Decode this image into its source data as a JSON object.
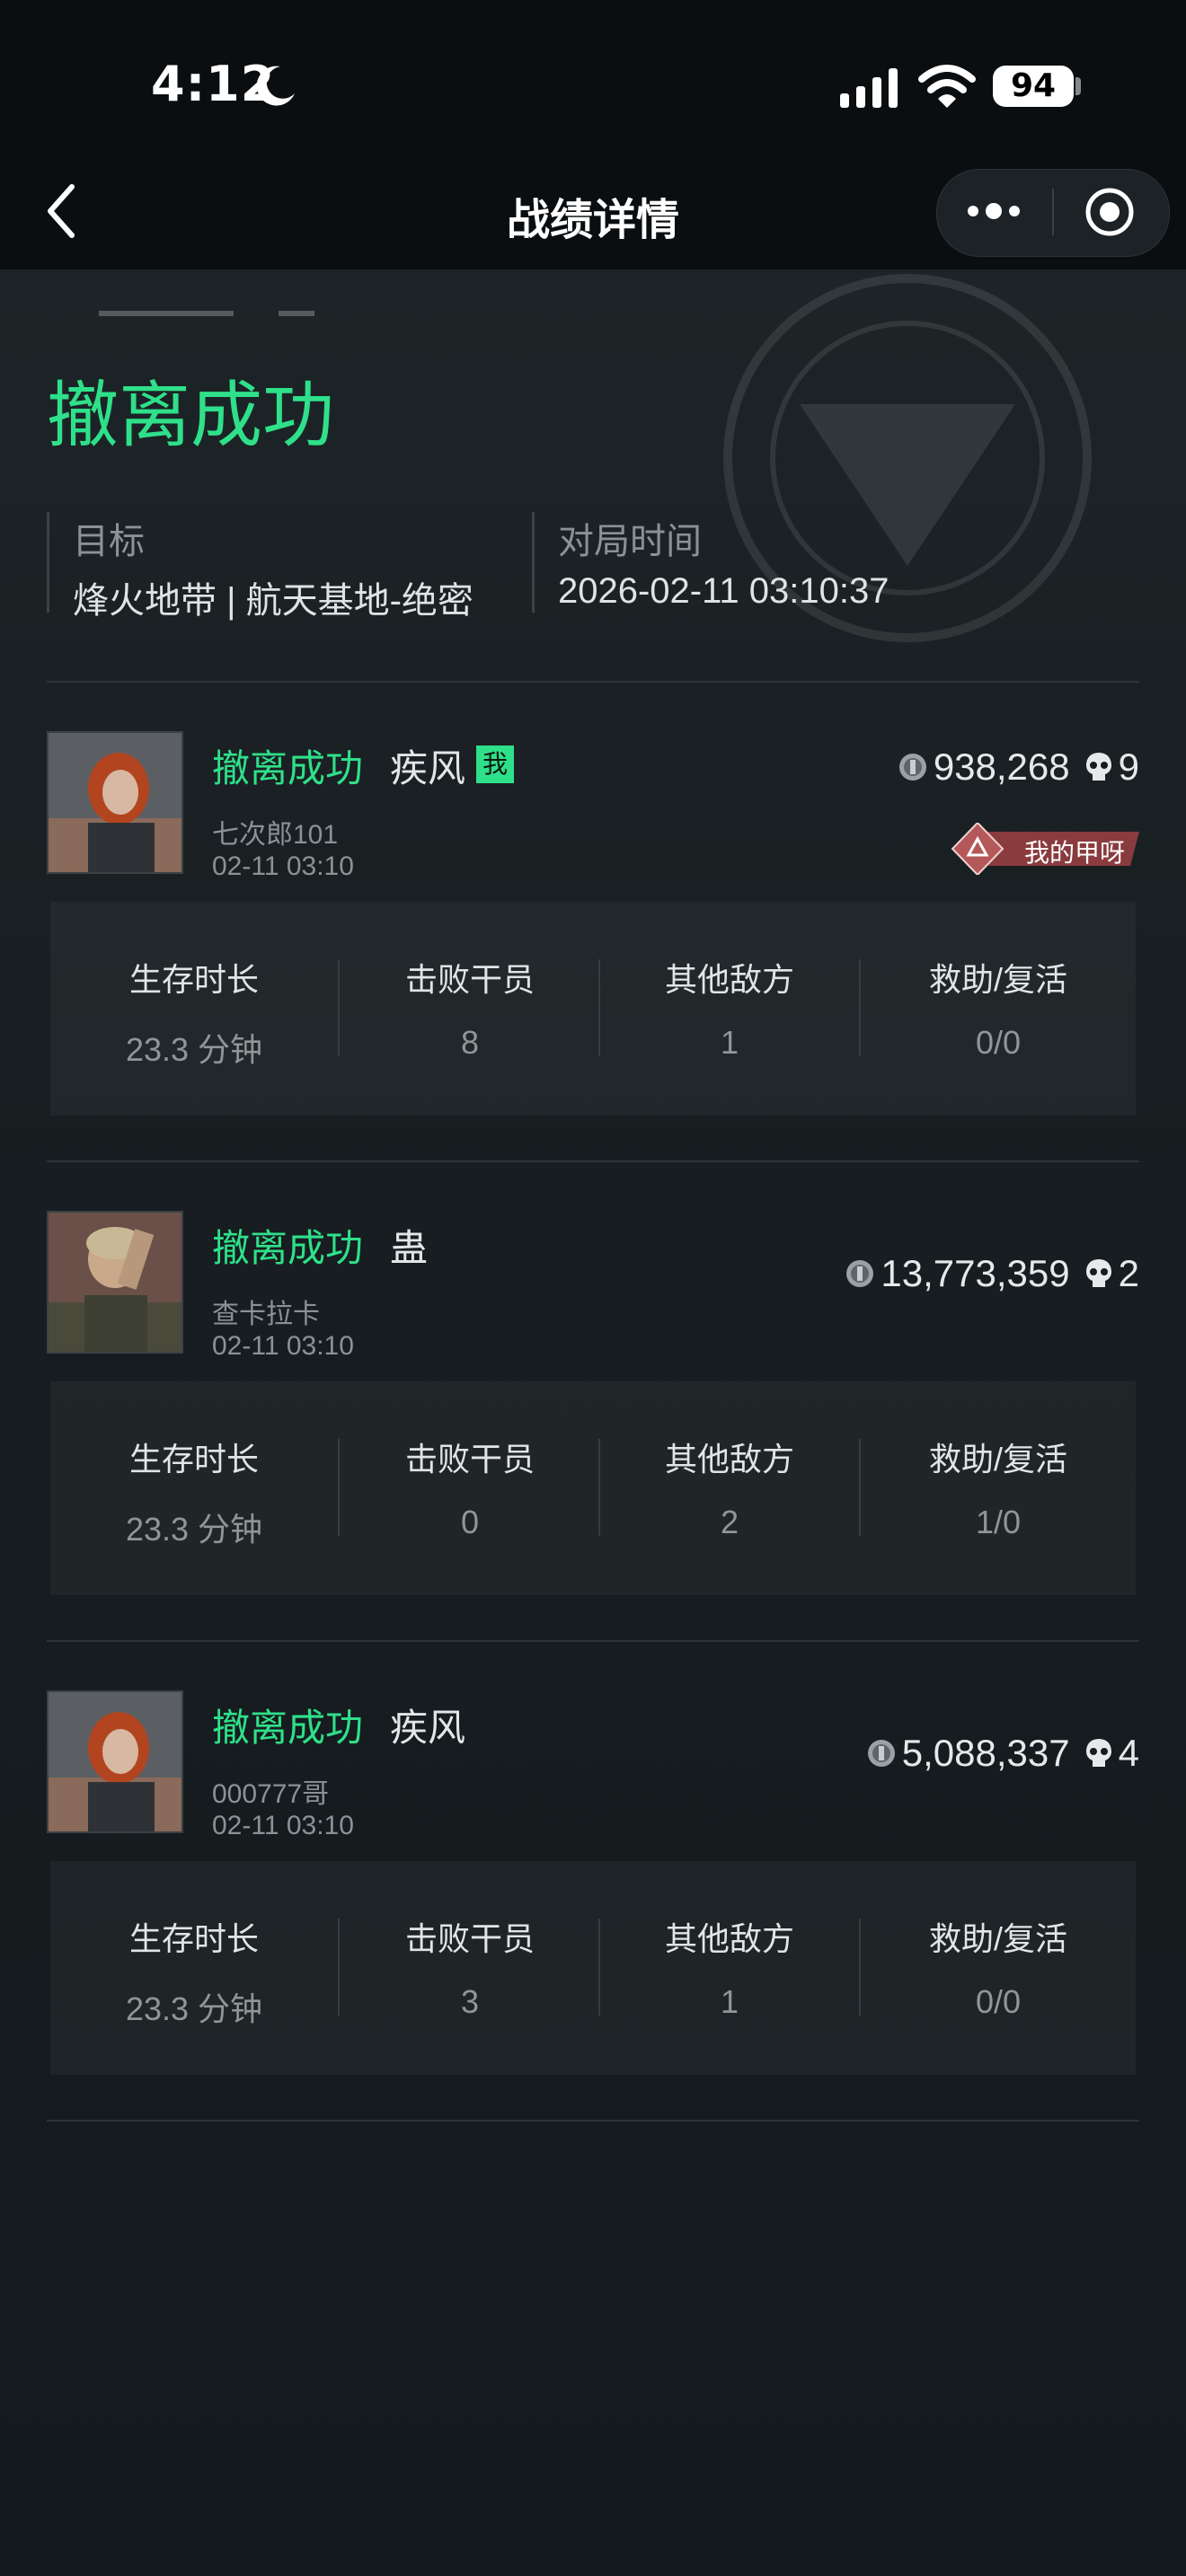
{
  "status_bar": {
    "time": "4:12",
    "battery": "94"
  },
  "nav": {
    "title": "战绩详情"
  },
  "result_headline": "撤离成功",
  "info": {
    "target_label": "目标",
    "target_value": "烽火地带 | 航天基地-绝密",
    "time_label": "对局时间",
    "time_value": "2026-02-11 03:10:37"
  },
  "stat_labels": {
    "survival": "生存时长",
    "defeated_operators": "击败干员",
    "other_enemies": "其他敌方",
    "assist_revive": "救助/复活"
  },
  "players": [
    {
      "status": "撤离成功",
      "operator": "疾风",
      "me_badge": "我",
      "player_name": "七次郎101",
      "time": "02-11 03:10",
      "value": "938,268",
      "kills": "9",
      "tag": "我的甲呀",
      "stats": {
        "survival": "23.3 分钟",
        "defeated_operators": "8",
        "other_enemies": "1",
        "assist_revive": "0/0"
      }
    },
    {
      "status": "撤离成功",
      "operator": "蛊",
      "player_name": "查卡拉卡",
      "time": "02-11 03:10",
      "value": "13,773,359",
      "kills": "2",
      "stats": {
        "survival": "23.3 分钟",
        "defeated_operators": "0",
        "other_enemies": "2",
        "assist_revive": "1/0"
      }
    },
    {
      "status": "撤离成功",
      "operator": "疾风",
      "player_name": "000777哥",
      "time": "02-11 03:10",
      "value": "5,088,337",
      "kills": "4",
      "stats": {
        "survival": "23.3 分钟",
        "defeated_operators": "3",
        "other_enemies": "1",
        "assist_revive": "0/0"
      }
    }
  ],
  "colors": {
    "accent_green": "#2fe08a",
    "background": "#151b1e",
    "tag_red": "#8a3b3e"
  },
  "icons": [
    "moon-icon",
    "signal-icon",
    "wifi-icon",
    "back-icon",
    "more-dots-icon",
    "target-icon",
    "coin-icon",
    "skull-icon",
    "tag-emblem-icon"
  ]
}
